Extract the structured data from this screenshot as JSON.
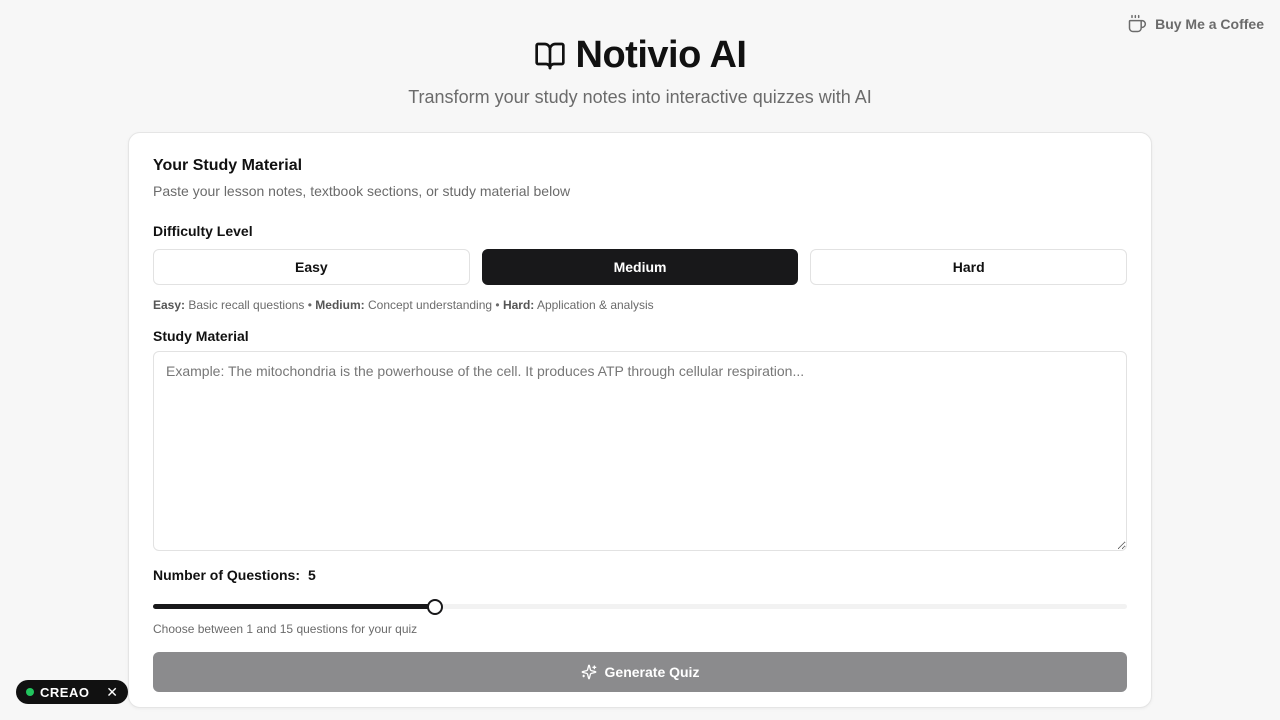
{
  "header": {
    "title": "Notivio AI",
    "subtitle": "Transform your study notes into interactive quizzes with AI",
    "coffee_label": "Buy Me a Coffee"
  },
  "card": {
    "title": "Your Study Material",
    "description": "Paste your lesson notes, textbook sections, or study material below",
    "difficulty": {
      "label": "Difficulty Level",
      "options": [
        "Easy",
        "Medium",
        "Hard"
      ],
      "selected": "Medium",
      "hint": {
        "easy_key": "Easy:",
        "easy_text": " Basic recall questions • ",
        "medium_key": "Medium:",
        "medium_text": " Concept understanding • ",
        "hard_key": "Hard:",
        "hard_text": " Application & analysis"
      }
    },
    "study_material": {
      "label": "Study Material",
      "value": "",
      "placeholder": "Example: The mitochondria is the powerhouse of the cell. It produces ATP through cellular respiration..."
    },
    "questions": {
      "label": "Number of Questions:",
      "value": 5,
      "min": 1,
      "max": 15,
      "hint": "Choose between 1 and 15 questions for your quiz"
    },
    "generate_label": "Generate Quiz"
  },
  "badge": {
    "brand": "CREAO",
    "close": "✕"
  },
  "icons": {
    "title": "book-open-icon",
    "coffee": "coffee-cup-icon",
    "generate": "sparkles-icon"
  },
  "colors": {
    "primary": "#18181a",
    "disabled_button": "#8b8b8d",
    "muted_text": "#6b6b6b",
    "badge_dot": "#22c55e"
  }
}
